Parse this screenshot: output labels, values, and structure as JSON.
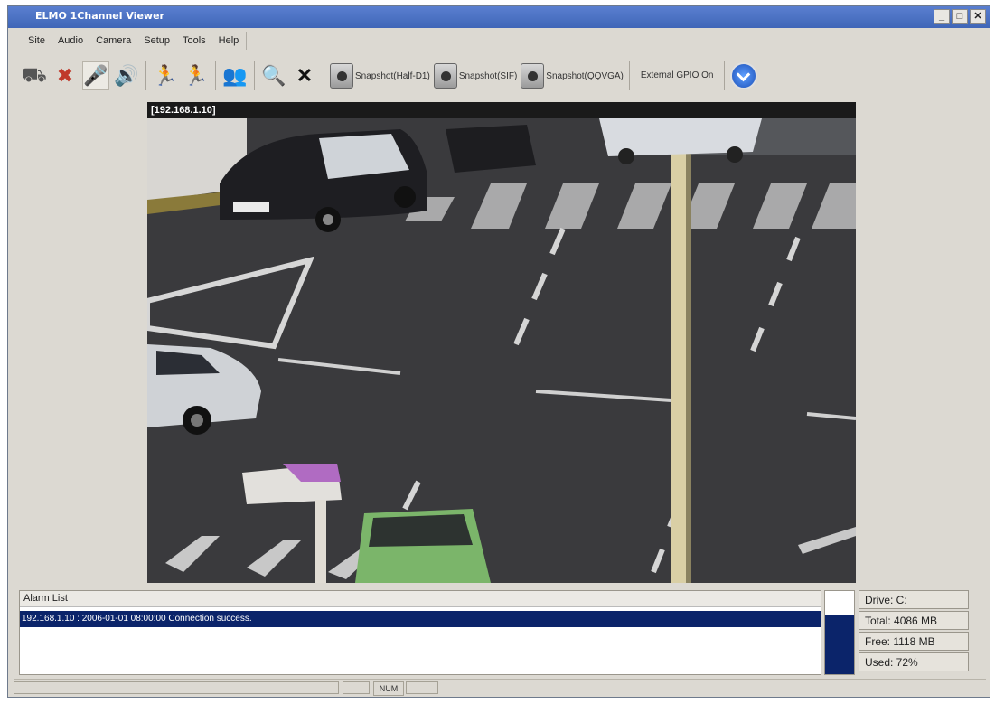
{
  "window": {
    "title": "ELMO 1Channel Viewer"
  },
  "menu": [
    "Site",
    "Audio",
    "Camera",
    "Setup",
    "Tools",
    "Help"
  ],
  "toolbar": {
    "snapshots": [
      "Snapshot(Half-D1)",
      "Snapshot(SIF)",
      "Snapshot(QQVGA)"
    ],
    "gpio_label": "External GPIO On"
  },
  "video": {
    "camera_label": "[192.168.1.10]"
  },
  "alarm": {
    "header": "Alarm List",
    "entries": [
      "192.168.1.10 : 2006-01-01 08:00:00 Connection success."
    ]
  },
  "drive": {
    "name": "Drive: C:",
    "total": "Total: 4086 MB",
    "free": "Free: 1118 MB",
    "used": "Used: 72%",
    "used_fraction": 0.72
  },
  "status": {
    "num": "NUM"
  },
  "colors": {
    "title_bar": "#3f66b8",
    "selection": "#0b246a"
  }
}
